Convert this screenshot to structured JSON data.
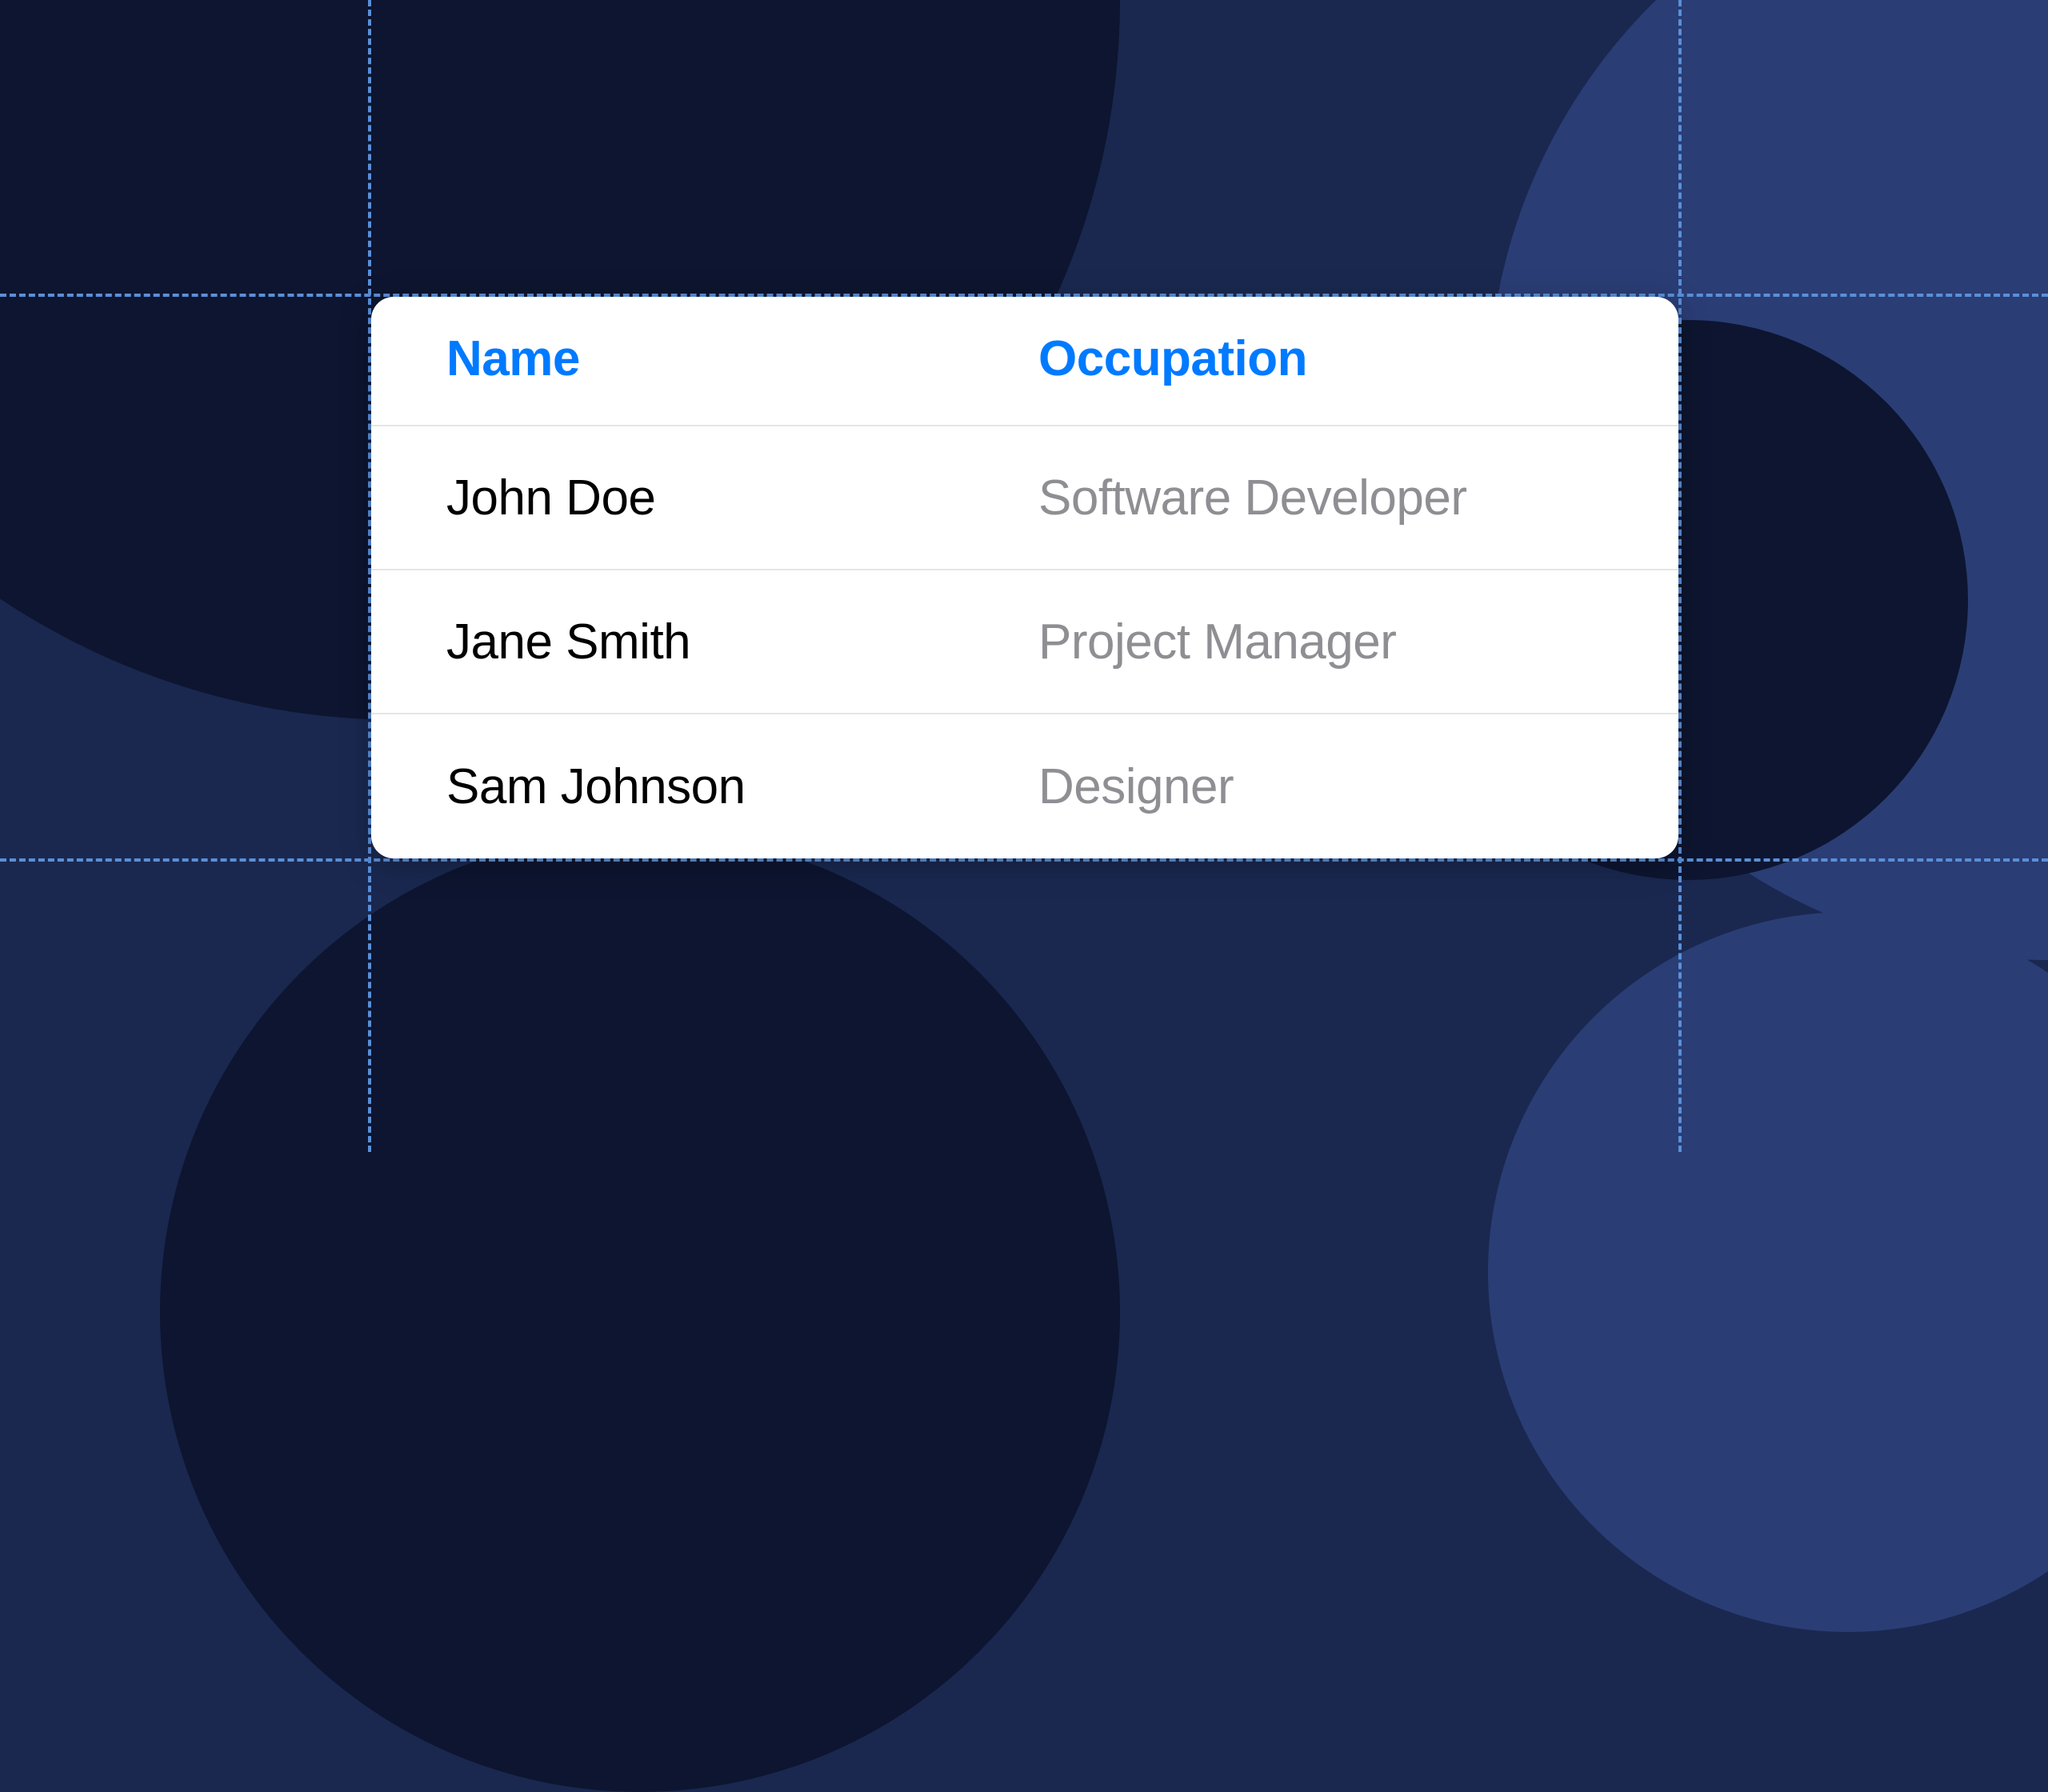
{
  "table": {
    "headers": {
      "name": "Name",
      "occupation": "Occupation"
    },
    "rows": [
      {
        "name": "John Doe",
        "occupation": "Software Developer"
      },
      {
        "name": "Jane Smith",
        "occupation": "Project Manager"
      },
      {
        "name": "Sam Johnson",
        "occupation": "Designer"
      }
    ]
  },
  "colors": {
    "accent": "#007aff",
    "secondary_text": "#8e8e93",
    "background_dark": "#1a2850",
    "guide_line": "#5a8fd8"
  }
}
